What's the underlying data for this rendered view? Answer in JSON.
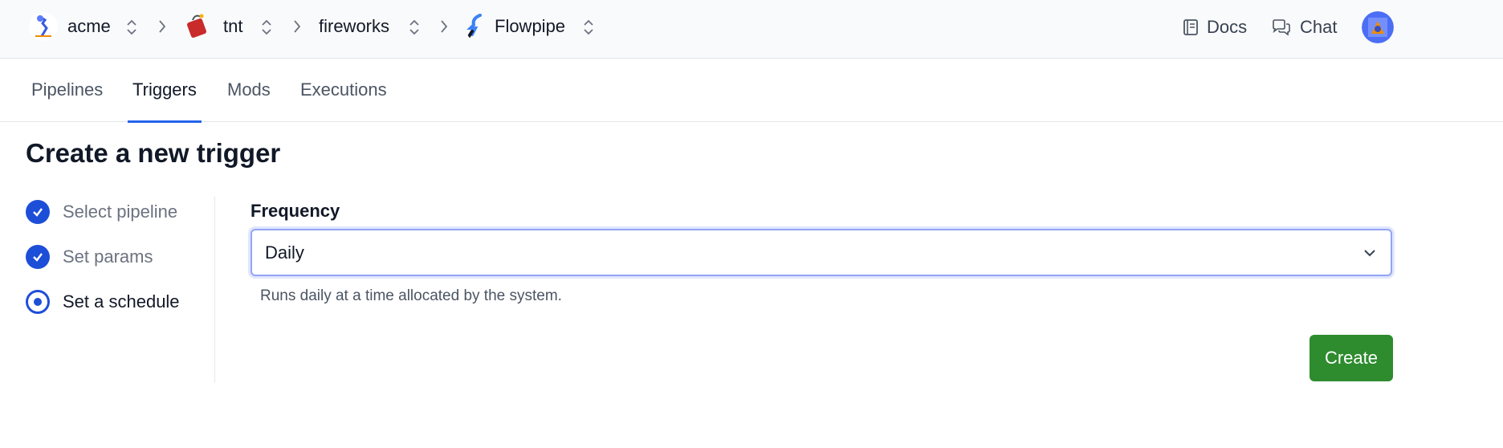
{
  "breadcrumb": {
    "org": "acme",
    "workspace": "tnt",
    "project": "fireworks",
    "app": "Flowpipe"
  },
  "header": {
    "docs_label": "Docs",
    "chat_label": "Chat"
  },
  "tabs": [
    {
      "label": "Pipelines",
      "active": false
    },
    {
      "label": "Triggers",
      "active": true
    },
    {
      "label": "Mods",
      "active": false
    },
    {
      "label": "Executions",
      "active": false
    }
  ],
  "page": {
    "title": "Create a new trigger"
  },
  "steps": [
    {
      "label": "Select pipeline",
      "status": "complete"
    },
    {
      "label": "Set params",
      "status": "complete"
    },
    {
      "label": "Set a schedule",
      "status": "current"
    }
  ],
  "form": {
    "frequency_label": "Frequency",
    "frequency_value": "Daily",
    "help_text": "Runs daily at a time allocated by the system.",
    "create_label": "Create"
  },
  "colors": {
    "accent": "#2563eb",
    "step": "#1d4ed8",
    "create_button": "#2e8b2e"
  }
}
